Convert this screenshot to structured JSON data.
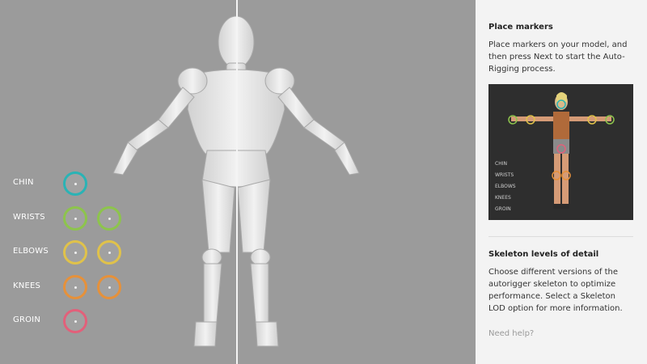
{
  "markers": [
    {
      "label": "CHIN",
      "rings": 1,
      "color": "#2ab3b5"
    },
    {
      "label": "WRISTS",
      "rings": 2,
      "color": "#8dc44c"
    },
    {
      "label": "ELBOWS",
      "rings": 2,
      "color": "#e0c24a"
    },
    {
      "label": "KNEES",
      "rings": 2,
      "color": "#e6913a"
    },
    {
      "label": "GROIN",
      "rings": 1,
      "color": "#e2607a"
    }
  ],
  "panel": {
    "place_title": "Place markers",
    "place_text": "Place markers on your model, and then press Next to start the Auto-Rigging process.",
    "preview_labels": [
      "CHIN",
      "WRISTS",
      "ELBOWS",
      "KNEES",
      "GROIN"
    ],
    "lod_title": "Skeleton levels of detail",
    "lod_text": "Choose different versions of the autorigger skeleton to optimize performance. Select a Skeleton LOD option for more information.",
    "help_link": "Need help?"
  }
}
